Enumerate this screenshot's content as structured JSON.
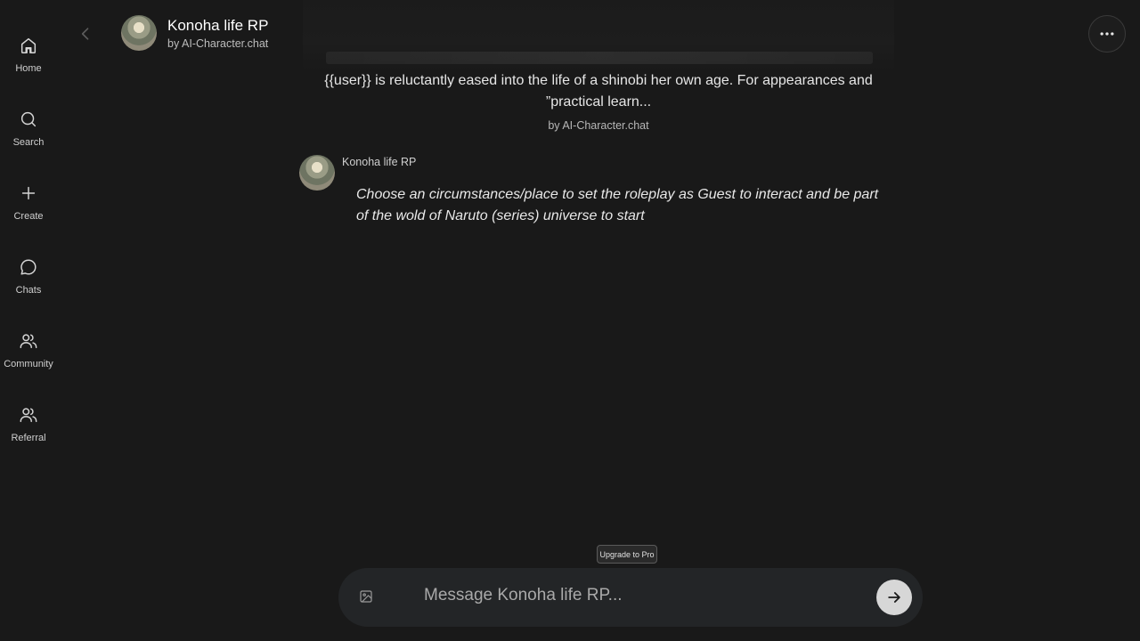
{
  "sidebar": {
    "items": [
      {
        "label": "Home",
        "icon": "home-icon"
      },
      {
        "label": "Search",
        "icon": "search-icon"
      },
      {
        "label": "Create",
        "icon": "plus-icon"
      },
      {
        "label": "Chats",
        "icon": "chat-bubble-icon"
      },
      {
        "label": "Community",
        "icon": "users-icon"
      },
      {
        "label": "Referral",
        "icon": "users-icon"
      }
    ]
  },
  "header": {
    "title": "Konoha life RP",
    "subtitle": "by AI-Character.chat"
  },
  "intro": {
    "text": "{{user}} is reluctantly eased into the life of a shinobi her own age. For appearances and ”practical learn...",
    "by": "by AI-Character.chat"
  },
  "messages": [
    {
      "sender": "Konoha life RP",
      "text": "Choose an circumstances/place to set the roleplay as Guest to interact and be part of the wold of Naruto (series) universe to start"
    }
  ],
  "composer": {
    "upgrade_label": "Upgrade to Pro",
    "placeholder": "Message Konoha life RP..."
  },
  "colors": {
    "background": "#191919",
    "composer_bg": "#232527",
    "send_button": "#d7d7d7"
  }
}
